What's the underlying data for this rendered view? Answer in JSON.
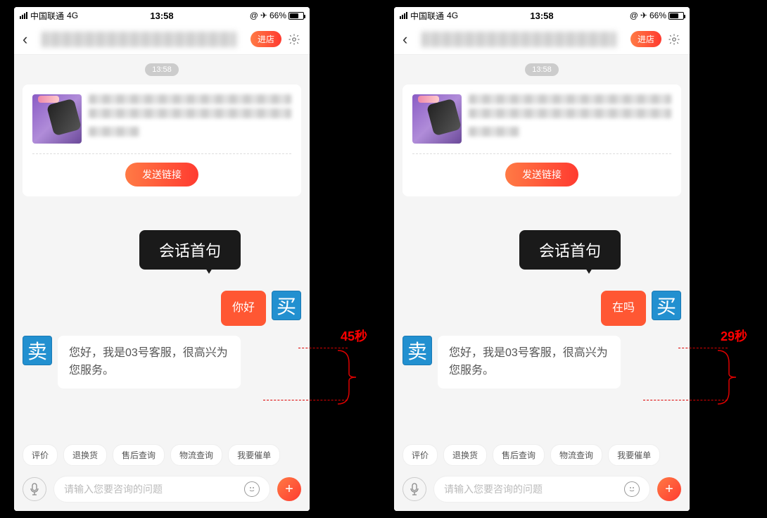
{
  "status": {
    "carrier": "中国联通",
    "network": "4G",
    "time": "13:58",
    "battery_pct": "66%",
    "loc_icon": "✈",
    "at_icon": "@"
  },
  "header": {
    "enter_shop": "进店"
  },
  "chat": {
    "time_badge": "13:58",
    "send_link": "发送链接",
    "annotation": "会话首句",
    "buyer_avatar": "买",
    "seller_avatar": "卖",
    "reply_text": "您好，我是03号客服，很高兴为您服务。"
  },
  "phones": [
    {
      "sent_text": "你好",
      "duration": "45秒"
    },
    {
      "sent_text": "在吗",
      "duration": "29秒"
    }
  ],
  "quick": [
    "评价",
    "退换货",
    "售后查询",
    "物流查询",
    "我要催单"
  ],
  "input": {
    "placeholder": "请输入您要咨询的问题"
  }
}
